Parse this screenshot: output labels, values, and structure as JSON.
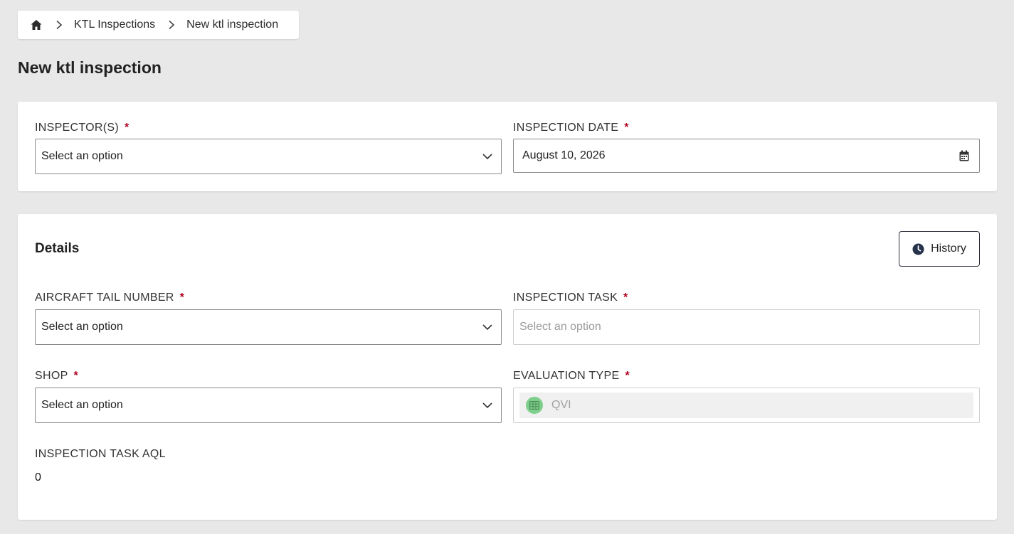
{
  "breadcrumb": {
    "items": [
      "KTL Inspections",
      "New ktl inspection"
    ]
  },
  "page": {
    "title": "New ktl inspection"
  },
  "header_card": {
    "inspectors": {
      "label": "INSPECTOR(S)",
      "required_mark": "*",
      "value": "Select an option"
    },
    "inspection_date": {
      "label": "INSPECTION DATE",
      "required_mark": "*",
      "value": "August 10, 2026"
    }
  },
  "details": {
    "title": "Details",
    "history_label": "History",
    "aircraft_tail_number": {
      "label": "AIRCRAFT TAIL NUMBER",
      "required_mark": "*",
      "value": "Select an option"
    },
    "inspection_task": {
      "label": "INSPECTION TASK",
      "required_mark": "*",
      "placeholder": "Select an option"
    },
    "shop": {
      "label": "SHOP",
      "required_mark": "*",
      "value": "Select an option"
    },
    "evaluation_type": {
      "label": "EVALUATION TYPE",
      "required_mark": "*",
      "value": "QVI"
    },
    "inspection_task_aql": {
      "label": "INSPECTION TASK AQL",
      "value": "0"
    }
  },
  "icons": {
    "home": "home-icon",
    "separator": "chevron-right-icon",
    "dropdown": "chevron-down-icon",
    "calendar": "calendar-icon",
    "history": "clock-icon",
    "evaluation": "grid-icon"
  },
  "colors": {
    "required": "#b00020",
    "evaluation_badge": "#7fcf8c",
    "background": "#e8e8e8"
  }
}
